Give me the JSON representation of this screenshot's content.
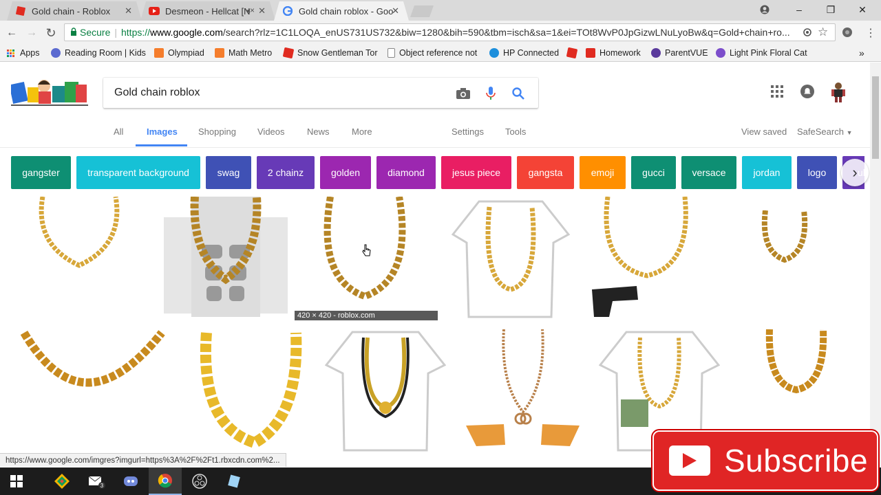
{
  "browser": {
    "tabs": [
      {
        "title": "Gold chain - Roblox",
        "favicon": "roblox-icon"
      },
      {
        "title": "Desmeon - Hellcat [N",
        "favicon": "youtube-icon"
      },
      {
        "title": "Gold chain roblox - Goo",
        "favicon": "google-icon"
      }
    ],
    "window_controls": {
      "user": "user-icon",
      "minimize": "–",
      "maximize": "❐",
      "close": "✕"
    },
    "nav": {
      "back": "←",
      "forward": "→",
      "reload": "↻"
    },
    "omnibox": {
      "secure_label": "Secure",
      "url_scheme": "https://",
      "url_host": "www.google.com",
      "url_rest": "/search?rlz=1C1LOQA_enUS731US732&biw=1280&bih=590&tbm=isch&sa=1&ei=TOt8WvP0JpGizwLNuLyoBw&q=Gold+chain+ro..."
    },
    "bookmarks": [
      {
        "label": "Apps",
        "color": "#e04d3b"
      },
      {
        "label": "Reading Room | Kids",
        "color": "#5b6ad0"
      },
      {
        "label": "Olympiad",
        "color": "#f57d2c"
      },
      {
        "label": "Math Metro",
        "color": "#f57d2c"
      },
      {
        "label": "Snow Gentleman Tor",
        "color": "#e02b20"
      },
      {
        "label": "Object reference not",
        "color": "#ffffff"
      },
      {
        "label": "HP Connected",
        "color": "#1d8fdc"
      },
      {
        "label": "",
        "color": "#e02b20"
      },
      {
        "label": "Homework",
        "color": "#e02b20"
      },
      {
        "label": "ParentVUE",
        "color": "#5a3a9c"
      },
      {
        "label": "Light Pink Floral Cat",
        "color": "#7c4ecb"
      }
    ],
    "bookmarks_more": "»",
    "status_url": "https://www.google.com/imgres?imgurl=https%3A%2F%2Ft1.rbxcdn.com%2..."
  },
  "google": {
    "query": "Gold chain roblox",
    "tabs": [
      {
        "label": "All",
        "active": false
      },
      {
        "label": "Images",
        "active": true
      },
      {
        "label": "Shopping",
        "active": false
      },
      {
        "label": "Videos",
        "active": false
      },
      {
        "label": "News",
        "active": false
      },
      {
        "label": "More",
        "active": false
      }
    ],
    "settings_label": "Settings",
    "tools_label": "Tools",
    "view_saved_label": "View saved",
    "safesearch_label": "SafeSearch",
    "chips": [
      {
        "label": "gangster",
        "color": "#0e8f73"
      },
      {
        "label": "transparent background",
        "color": "#16c1d6"
      },
      {
        "label": "swag",
        "color": "#3f51b5"
      },
      {
        "label": "2 chainz",
        "color": "#673ab7"
      },
      {
        "label": "golden",
        "color": "#9c27b0"
      },
      {
        "label": "diamond",
        "color": "#9c27b0"
      },
      {
        "label": "jesus piece",
        "color": "#e91e63"
      },
      {
        "label": "gangsta",
        "color": "#f44336"
      },
      {
        "label": "emoji",
        "color": "#ff8f00"
      },
      {
        "label": "gucci",
        "color": "#0e8f73"
      },
      {
        "label": "versace",
        "color": "#0e8f73"
      },
      {
        "label": "jordan",
        "color": "#16c1d6"
      },
      {
        "label": "logo",
        "color": "#3f51b5"
      },
      {
        "label": "ul",
        "color": "#673ab7"
      }
    ],
    "hover_caption": "420 × 420 - roblox.com"
  },
  "overlay": {
    "subscribe_label": "Subscribe"
  },
  "taskbar": {
    "discord_badge": "3"
  }
}
